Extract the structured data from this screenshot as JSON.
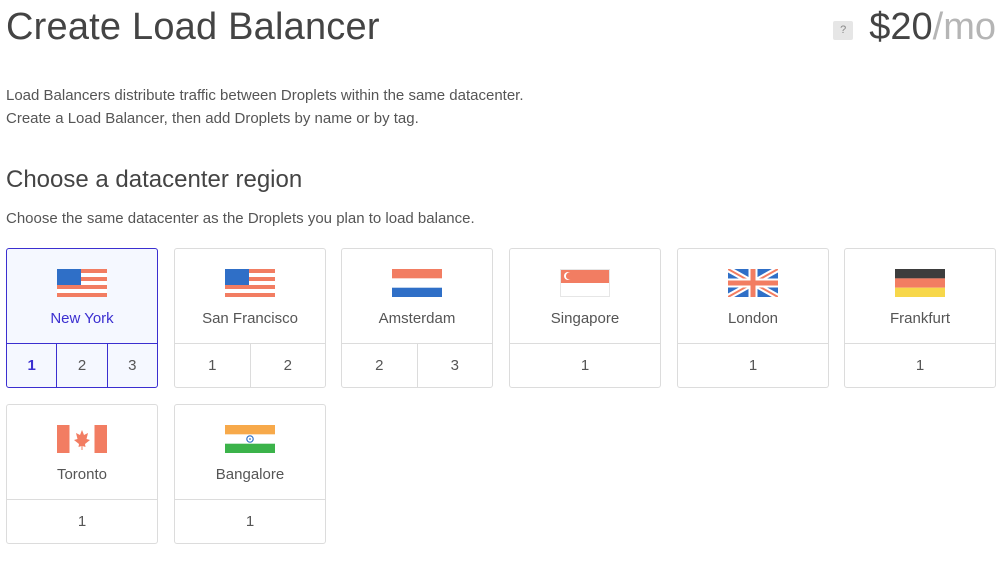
{
  "header": {
    "title": "Create Load Balancer",
    "help_glyph": "?",
    "price_amount": "$20",
    "price_unit": "/mo"
  },
  "intro": {
    "line1": "Load Balancers distribute traffic between Droplets within the same datacenter.",
    "line2": "Create a Load Balancer, then add Droplets by name or by tag."
  },
  "region_section": {
    "title": "Choose a datacenter region",
    "subtitle": "Choose the same datacenter as the Droplets you plan to load balance."
  },
  "colors": {
    "accent": "#3b2fd0",
    "card_border": "#dcdcdc",
    "selected_bg": "#f5f8ff"
  },
  "regions": [
    {
      "city": "New York",
      "flag": "us-flag-icon",
      "datacenters": [
        "1",
        "2",
        "3"
      ],
      "selected": true,
      "active_dc": "1"
    },
    {
      "city": "San Francisco",
      "flag": "us-flag-icon",
      "datacenters": [
        "1",
        "2"
      ]
    },
    {
      "city": "Amsterdam",
      "flag": "netherlands-flag-icon",
      "datacenters": [
        "2",
        "3"
      ]
    },
    {
      "city": "Singapore",
      "flag": "singapore-flag-icon",
      "datacenters": [
        "1"
      ]
    },
    {
      "city": "London",
      "flag": "uk-flag-icon",
      "datacenters": [
        "1"
      ]
    },
    {
      "city": "Frankfurt",
      "flag": "germany-flag-icon",
      "datacenters": [
        "1"
      ]
    },
    {
      "city": "Toronto",
      "flag": "canada-flag-icon",
      "datacenters": [
        "1"
      ]
    },
    {
      "city": "Bangalore",
      "flag": "india-flag-icon",
      "datacenters": [
        "1"
      ]
    }
  ]
}
